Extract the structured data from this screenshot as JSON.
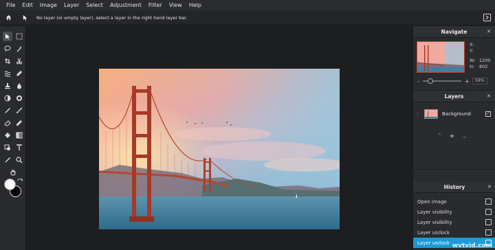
{
  "menu": [
    "File",
    "Edit",
    "Image",
    "Layer",
    "Select",
    "Adjustment",
    "Filter",
    "View",
    "Help"
  ],
  "options": {
    "message": "No layer (or empty layer), select a layer in the right hand layer bar."
  },
  "tools": [
    "move-tool",
    "marquee-tool",
    "lasso-tool",
    "magic-wand-tool",
    "crop-tool",
    "cut-tool",
    "liquify-tool",
    "healing-tool",
    "stamp-tool",
    "blur-tool",
    "dodge-tool",
    "sponge-tool",
    "pen-tool",
    "brush-tool",
    "eraser-tool",
    "pencil-tool",
    "fill-tool",
    "gradient-tool",
    "shape-tool",
    "text-tool",
    "eyedropper-tool",
    "zoom-tool",
    "hand-tool"
  ],
  "colors": {
    "foreground": "#ffffff",
    "background": "#000000",
    "accent": "#1a9ad6"
  },
  "navigate": {
    "title": "Navigate",
    "x_label": "X:",
    "x_value": "",
    "y_label": "Y:",
    "y_value": "",
    "w_label": "W:",
    "w_value": "1200",
    "h_label": "H:",
    "h_value": "802",
    "zoom_minus": "-",
    "zoom_plus": "+",
    "zoom": "59%",
    "zoom_fraction": 0.2
  },
  "layers": {
    "title": "Layers",
    "items": [
      {
        "name": "Background",
        "visible": true
      }
    ],
    "up": "^",
    "add": "+",
    "down": "v"
  },
  "history": {
    "title": "History",
    "items": [
      {
        "label": "Open image",
        "selected": false
      },
      {
        "label": "Layer visibility",
        "selected": false
      },
      {
        "label": "Layer visibility",
        "selected": false
      },
      {
        "label": "Layer un/lock",
        "selected": false
      },
      {
        "label": "Layer un/lock",
        "selected": true
      }
    ]
  },
  "watermark": "wvtvid.com"
}
